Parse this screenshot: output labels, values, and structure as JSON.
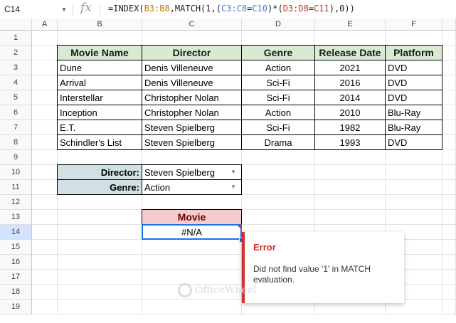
{
  "formula_bar": {
    "name_box": "C14",
    "fx": "fx",
    "formula_parts": [
      {
        "t": "=INDEX(",
        "c": ""
      },
      {
        "t": "B3:B8",
        "c": "r-b"
      },
      {
        "t": ",MATCH(1,(",
        "c": ""
      },
      {
        "t": "C3:C8",
        "c": "r-c"
      },
      {
        "t": "=",
        "c": ""
      },
      {
        "t": "C10",
        "c": "r-c"
      },
      {
        "t": ")*(",
        "c": ""
      },
      {
        "t": "D3:D8",
        "c": "r-d"
      },
      {
        "t": "=",
        "c": ""
      },
      {
        "t": "C11",
        "c": "r-d"
      },
      {
        "t": "),0))",
        "c": ""
      }
    ]
  },
  "columns": [
    "A",
    "B",
    "C",
    "D",
    "E",
    "F"
  ],
  "rows": [
    "1",
    "2",
    "3",
    "4",
    "5",
    "6",
    "7",
    "8",
    "9",
    "10",
    "11",
    "12",
    "13",
    "14",
    "15",
    "16",
    "17",
    "18",
    "19"
  ],
  "table": {
    "headers": [
      "Movie Name",
      "Director",
      "Genre",
      "Release Date",
      "Platform"
    ],
    "rows": [
      [
        "Dune",
        "Denis Villeneuve",
        "Action",
        "2021",
        "DVD"
      ],
      [
        "Arrival",
        "Denis Villeneuve",
        "Sci-Fi",
        "2016",
        "DVD"
      ],
      [
        "Interstellar",
        "Christopher Nolan",
        "Sci-Fi",
        "2014",
        "DVD"
      ],
      [
        "Inception",
        "Christopher Nolan",
        "Action",
        "2010",
        "Blu-Ray"
      ],
      [
        "E.T.",
        "Steven Spielberg",
        "Sci-Fi",
        "1982",
        "Blu-Ray"
      ],
      [
        "Schindler's List",
        "Steven Spielberg",
        "Drama",
        "1993",
        "DVD"
      ]
    ]
  },
  "criteria": {
    "director_label": "Director:",
    "director_value": "Steven Spielberg",
    "genre_label": "Genre:",
    "genre_value": "Action"
  },
  "result": {
    "header": "Movie",
    "value": "#N/A"
  },
  "error_tooltip": {
    "title": "Error",
    "message": "Did not find value '1' in MATCH evaluation."
  },
  "watermark": "OfficeWheel",
  "colors": {
    "table_header": "#d9ead3",
    "criteria_label": "#d0e0e3",
    "movie_header": "#f4cccc",
    "error": "#d32f2f",
    "selection": "#1a73e8"
  }
}
